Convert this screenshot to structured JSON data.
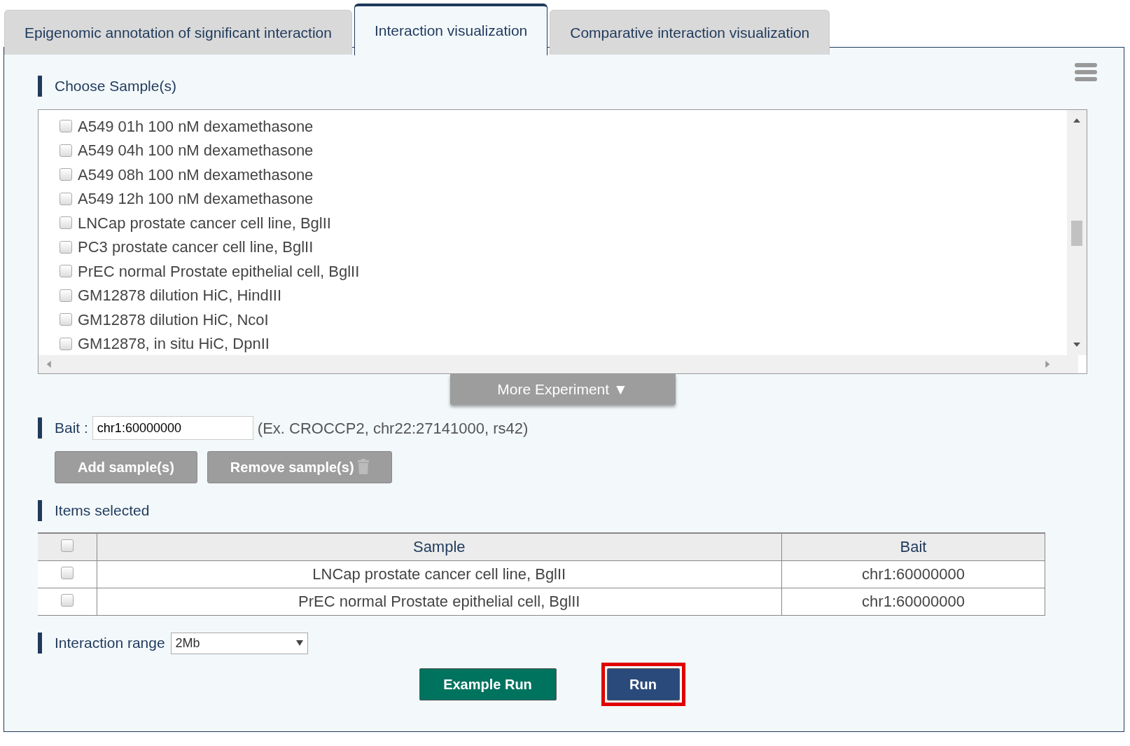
{
  "tabs": [
    {
      "label": "Epigenomic annotation of significant interaction",
      "selected": false
    },
    {
      "label": "Interaction visualization",
      "selected": true
    },
    {
      "label": "Comparative interaction visualization",
      "selected": false
    }
  ],
  "choose_samples": {
    "heading": "Choose Sample(s)",
    "options": [
      {
        "label": "A549 01h 100 nM dexamethasone",
        "checked": false
      },
      {
        "label": "A549 04h 100 nM dexamethasone",
        "checked": false
      },
      {
        "label": "A549 08h 100 nM dexamethasone",
        "checked": false
      },
      {
        "label": "A549 12h 100 nM dexamethasone",
        "checked": false
      },
      {
        "label": "LNCap prostate cancer cell line, BglII",
        "checked": false
      },
      {
        "label": "PC3 prostate cancer cell line, BglII",
        "checked": false
      },
      {
        "label": "PrEC normal Prostate epithelial cell, BglII",
        "checked": false
      },
      {
        "label": "GM12878 dilution HiC, HindIII",
        "checked": false
      },
      {
        "label": "GM12878 dilution HiC, NcoI",
        "checked": false
      },
      {
        "label": "GM12878, in situ HiC, DpnII",
        "checked": false
      }
    ],
    "more_button": {
      "label": "More Experiment",
      "arrow": "▼"
    }
  },
  "bait": {
    "label": "Bait :",
    "value": "chr1:60000000",
    "hint": "(Ex. CROCCP2, chr22:27141000, rs42)"
  },
  "sample_buttons": [
    {
      "label": "Add sample(s)",
      "kind": "add"
    },
    {
      "label": "Remove sample(s)",
      "kind": "remove"
    }
  ],
  "items_selected": {
    "heading": "Items selected",
    "header_checked": false,
    "columns": [
      "Sample",
      "Bait"
    ],
    "rows": [
      {
        "sample": "LNCap prostate cancer cell line, BglII",
        "bait": "chr1:60000000",
        "checked": false
      },
      {
        "sample": "PrEC normal Prostate epithelial cell, BglII",
        "bait": "chr1:60000000",
        "checked": false
      }
    ]
  },
  "interaction_range": {
    "label": "Interaction range",
    "value": "2Mb"
  },
  "actions": [
    {
      "label": "Example Run",
      "kind": "example",
      "highlighted": false
    },
    {
      "label": "Run",
      "kind": "run",
      "highlighted": true
    }
  ]
}
